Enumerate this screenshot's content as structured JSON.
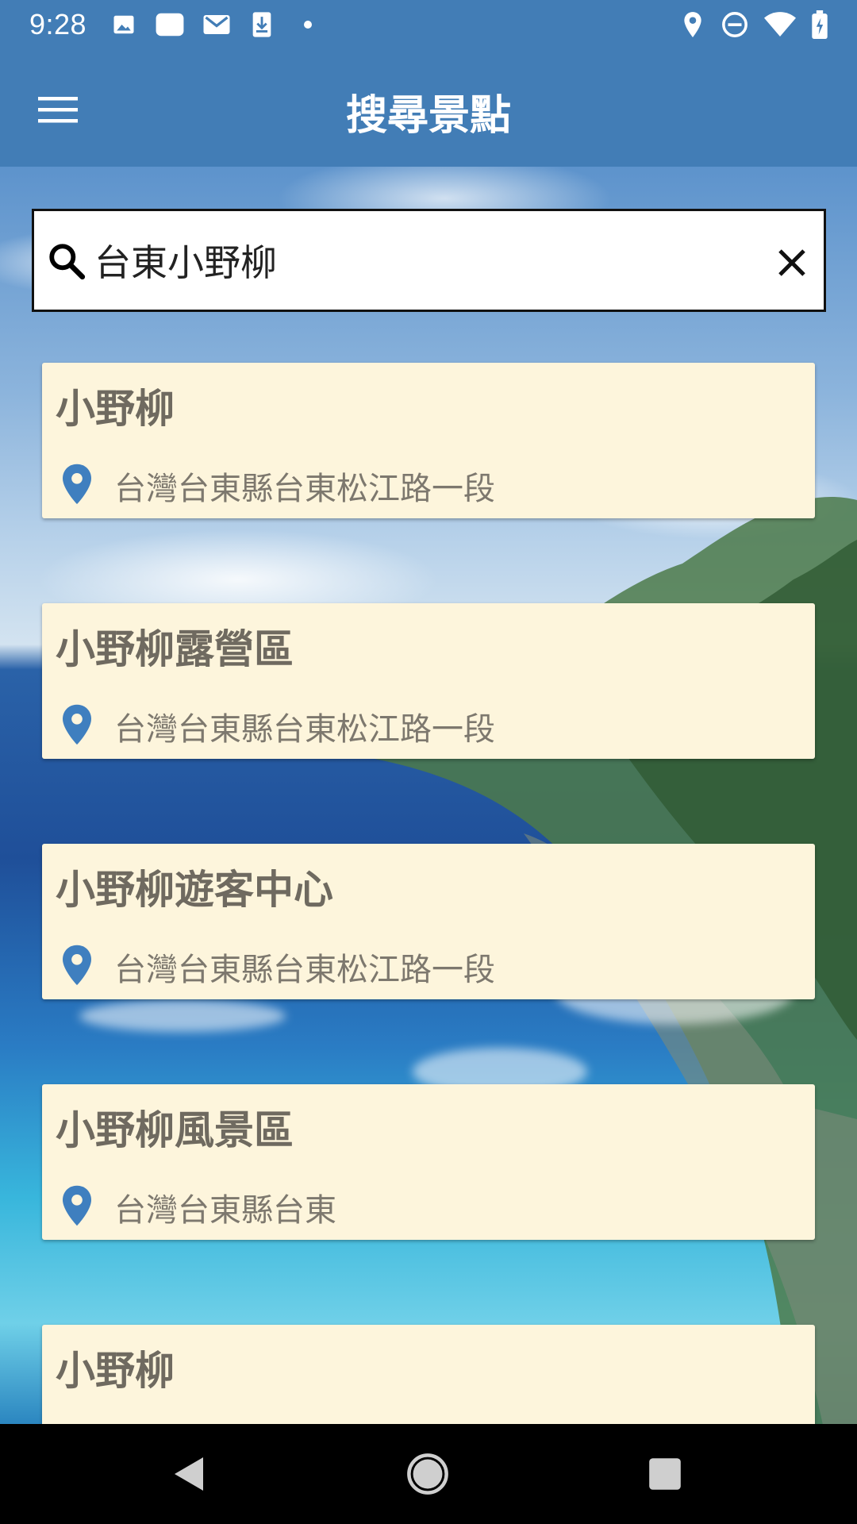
{
  "status_bar": {
    "time": "9:28",
    "left_icons": [
      "image-icon",
      "cloud-icon",
      "gmail-icon",
      "download-icon",
      "dot-icon"
    ],
    "right_icons": [
      "location-icon",
      "do-not-disturb-icon",
      "wifi-icon",
      "battery-icon"
    ]
  },
  "app_bar": {
    "title": "搜尋景點",
    "menu_icon": "hamburger-menu-icon"
  },
  "search": {
    "value": "台東小野柳",
    "icon": "search-icon",
    "clear_icon": "close-icon"
  },
  "results": [
    {
      "name": "小野柳",
      "address": "台灣台東縣台東松江路一段"
    },
    {
      "name": "小野柳露營區",
      "address": "台灣台東縣台東松江路一段"
    },
    {
      "name": "小野柳遊客中心",
      "address": "台灣台東縣台東松江路一段"
    },
    {
      "name": "小野柳風景區",
      "address": "台灣台東縣台東"
    },
    {
      "name": "小野柳",
      "address": ""
    }
  ],
  "colors": {
    "app_bar": "#427db6",
    "card_bg": "#fdf5dc",
    "pin": "#3f7fbf"
  },
  "nav_bar": {
    "buttons": [
      "back-icon",
      "home-icon",
      "recents-icon"
    ]
  }
}
